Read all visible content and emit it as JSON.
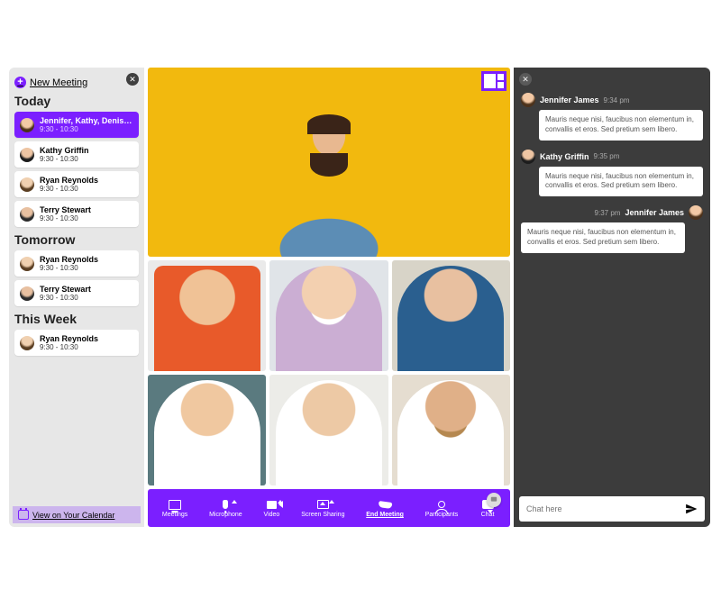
{
  "sidebar": {
    "new_meeting_label": "New Meeting",
    "view_calendar_label": "View on Your Calendar",
    "sections": {
      "today": {
        "title": "Today",
        "items": [
          {
            "name": "Jennifer, Kathy, Denise...",
            "time": "9:30 - 10:30",
            "active": true
          },
          {
            "name": "Kathy Griffin",
            "time": "9:30 - 10:30"
          },
          {
            "name": "Ryan Reynolds",
            "time": "9:30 - 10:30"
          },
          {
            "name": "Terry Stewart",
            "time": "9:30 - 10:30"
          }
        ]
      },
      "tomorrow": {
        "title": "Tomorrow",
        "items": [
          {
            "name": "Ryan Reynolds",
            "time": "9:30 - 10:30"
          },
          {
            "name": "Terry Stewart",
            "time": "9:30 - 10:30"
          }
        ]
      },
      "this_week": {
        "title": "This Week",
        "items": [
          {
            "name": "Ryan Reynolds",
            "time": "9:30 - 10:30"
          }
        ]
      }
    }
  },
  "toolbar": {
    "meetings": "Meetings",
    "microphone": "Microphone",
    "video": "Video",
    "screen_sharing": "Screen Sharing",
    "end_meeting": "End Meeting",
    "participants": "Participants",
    "chat": "Chat"
  },
  "chat": {
    "placeholder": "Chat here",
    "messages": [
      {
        "name": "Jennifer James",
        "time": "9:34 pm",
        "text": "Mauris neque nisi, faucibus non elementum in, convallis et eros. Sed pretium sem libero.",
        "side": "left"
      },
      {
        "name": "Kathy Griffin",
        "time": "9:35 pm",
        "text": "Mauris neque nisi, faucibus non elementum in, convallis et eros. Sed pretium sem libero.",
        "side": "left"
      },
      {
        "name": "Jennifer James",
        "time": "9:37 pm",
        "text": "Mauris neque nisi, faucibus non elementum in, convallis et eros. Sed pretium sem libero.",
        "side": "right"
      }
    ]
  },
  "colors": {
    "brand": "#7b1fff"
  }
}
